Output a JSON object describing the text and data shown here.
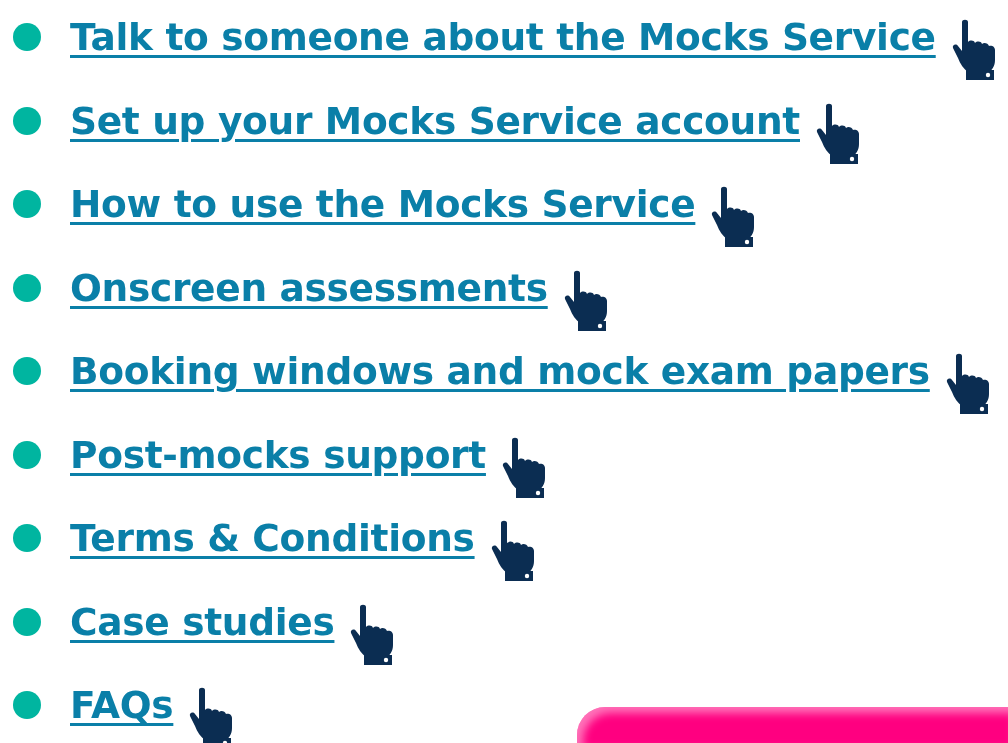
{
  "links": [
    {
      "label": "Talk to someone about the Mocks Service"
    },
    {
      "label": "Set up your Mocks Service account"
    },
    {
      "label": "How to use the Mocks Service"
    },
    {
      "label": "Onscreen assessments"
    },
    {
      "label": "Booking windows and mock exam papers"
    },
    {
      "label": "Post-mocks support"
    },
    {
      "label": "Terms & Conditions"
    },
    {
      "label": "Case studies"
    },
    {
      "label": "FAQs"
    }
  ]
}
